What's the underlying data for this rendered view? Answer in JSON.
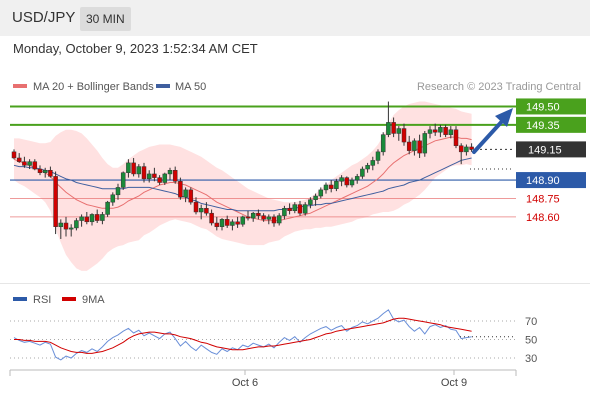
{
  "header": {
    "symbol": "USD/JPY",
    "timeframe": "30 MIN",
    "datetime": "Monday, October 9, 2023 1:52:34 AM CET"
  },
  "legend": {
    "ma20": "MA 20 + Bollinger Bands",
    "ma50": "MA 50",
    "copyright": "Research © 2023 Trading Central",
    "rsi": "RSI",
    "ma9": "9MA"
  },
  "colors": {
    "green": "#4aa11d",
    "blue": "#2c5aa8",
    "red": "#e87070",
    "ma20": "#e87070",
    "ma50": "#3f5f9f",
    "band": "#ffd9d9",
    "candle": "#1a8a3a",
    "bear": "#d10000"
  },
  "chart_data": [
    {
      "type": "candlestick",
      "ylim": [
        148.42,
        149.74
      ],
      "levels": [
        {
          "label": "149.50",
          "value": 149.5,
          "kind": "resistance"
        },
        {
          "label": "149.35",
          "value": 149.35,
          "kind": "resistance"
        },
        {
          "label": "149.15",
          "value": 149.15,
          "kind": "current"
        },
        {
          "label": "148.90",
          "value": 148.9,
          "kind": "pivot"
        },
        {
          "label": "148.75",
          "value": 148.75,
          "kind": "support"
        },
        {
          "label": "148.60",
          "value": 148.6,
          "kind": "support"
        }
      ],
      "x_ticks": [
        "Oct 6",
        "Oct 9"
      ],
      "candles": [
        [
          149.13,
          149.15,
          149.07,
          149.08
        ],
        [
          149.08,
          149.12,
          149.04,
          149.05
        ],
        [
          149.05,
          149.09,
          149.0,
          149.02
        ],
        [
          149.02,
          149.07,
          148.99,
          149.05
        ],
        [
          149.05,
          149.07,
          148.98,
          148.99
        ],
        [
          148.99,
          149.02,
          148.94,
          148.96
        ],
        [
          148.96,
          149.0,
          148.92,
          148.98
        ],
        [
          148.98,
          149.01,
          148.92,
          148.93
        ],
        [
          148.93,
          148.97,
          148.46,
          148.52
        ],
        [
          148.52,
          148.58,
          148.42,
          148.55
        ],
        [
          148.55,
          148.6,
          148.44,
          148.5
        ],
        [
          148.5,
          148.54,
          148.44,
          148.51
        ],
        [
          148.51,
          148.59,
          148.49,
          148.57
        ],
        [
          148.57,
          148.62,
          148.52,
          148.6
        ],
        [
          148.6,
          148.64,
          148.54,
          148.56
        ],
        [
          148.56,
          148.63,
          148.53,
          148.62
        ],
        [
          148.62,
          148.66,
          148.55,
          148.57
        ],
        [
          148.57,
          148.64,
          148.54,
          148.62
        ],
        [
          148.62,
          148.73,
          148.6,
          148.72
        ],
        [
          148.72,
          148.8,
          148.69,
          148.78
        ],
        [
          148.78,
          148.87,
          148.74,
          148.84
        ],
        [
          148.84,
          148.97,
          148.82,
          148.96
        ],
        [
          148.96,
          149.07,
          148.92,
          149.04
        ],
        [
          149.04,
          149.08,
          148.93,
          148.95
        ],
        [
          148.95,
          149.03,
          148.92,
          149.01
        ],
        [
          149.01,
          149.04,
          148.88,
          148.91
        ],
        [
          148.91,
          148.98,
          148.88,
          148.95
        ],
        [
          148.95,
          149.0,
          148.89,
          148.92
        ],
        [
          148.92,
          148.94,
          148.86,
          148.88
        ],
        [
          148.88,
          148.96,
          148.86,
          148.95
        ],
        [
          148.95,
          149.0,
          148.9,
          148.98
        ],
        [
          148.98,
          149.01,
          148.87,
          148.89
        ],
        [
          148.89,
          148.92,
          148.74,
          148.76
        ],
        [
          148.76,
          148.84,
          148.72,
          148.82
        ],
        [
          148.82,
          148.84,
          148.7,
          148.72
        ],
        [
          148.72,
          148.76,
          148.62,
          148.64
        ],
        [
          148.64,
          148.7,
          148.58,
          148.67
        ],
        [
          148.67,
          148.72,
          148.61,
          148.63
        ],
        [
          148.63,
          148.66,
          148.53,
          148.55
        ],
        [
          148.55,
          148.6,
          148.49,
          148.52
        ],
        [
          148.52,
          148.59,
          148.49,
          148.58
        ],
        [
          148.58,
          148.61,
          148.51,
          148.53
        ],
        [
          148.53,
          148.58,
          148.49,
          148.56
        ],
        [
          148.56,
          148.6,
          148.51,
          148.54
        ],
        [
          148.54,
          148.61,
          148.52,
          148.6
        ],
        [
          148.6,
          148.65,
          148.57,
          148.59
        ],
        [
          148.59,
          148.64,
          148.56,
          148.63
        ],
        [
          148.63,
          148.66,
          148.58,
          148.61
        ],
        [
          148.61,
          148.63,
          148.56,
          148.58
        ],
        [
          148.58,
          148.62,
          148.54,
          148.6
        ],
        [
          148.6,
          148.62,
          148.52,
          148.55
        ],
        [
          148.55,
          148.63,
          148.53,
          148.61
        ],
        [
          148.61,
          148.69,
          148.58,
          148.67
        ],
        [
          148.67,
          148.71,
          148.62,
          148.65
        ],
        [
          148.65,
          148.72,
          148.63,
          148.7
        ],
        [
          148.7,
          148.73,
          148.61,
          148.63
        ],
        [
          148.63,
          148.72,
          148.61,
          148.7
        ],
        [
          148.7,
          148.76,
          148.67,
          148.74
        ],
        [
          148.74,
          148.79,
          148.69,
          148.77
        ],
        [
          148.77,
          148.84,
          148.75,
          148.82
        ],
        [
          148.82,
          148.88,
          148.79,
          148.86
        ],
        [
          148.86,
          148.9,
          148.8,
          148.83
        ],
        [
          148.83,
          148.91,
          148.81,
          148.89
        ],
        [
          148.89,
          148.94,
          148.85,
          148.92
        ],
        [
          148.92,
          148.93,
          148.84,
          148.86
        ],
        [
          148.86,
          148.92,
          148.84,
          148.9
        ],
        [
          148.9,
          148.95,
          148.87,
          148.93
        ],
        [
          148.93,
          149.01,
          148.91,
          148.99
        ],
        [
          148.99,
          149.04,
          148.96,
          149.02
        ],
        [
          149.02,
          149.09,
          148.98,
          149.06
        ],
        [
          149.06,
          149.15,
          149.03,
          149.13
        ],
        [
          149.13,
          149.29,
          149.1,
          149.27
        ],
        [
          149.27,
          149.54,
          149.25,
          149.37
        ],
        [
          149.37,
          149.41,
          149.25,
          149.28
        ],
        [
          149.28,
          149.34,
          149.22,
          149.32
        ],
        [
          149.32,
          149.36,
          149.18,
          149.21
        ],
        [
          149.21,
          149.26,
          149.11,
          149.14
        ],
        [
          149.14,
          149.24,
          149.1,
          149.22
        ],
        [
          149.22,
          149.27,
          149.08,
          149.12
        ],
        [
          149.12,
          149.3,
          149.09,
          149.28
        ],
        [
          149.28,
          149.34,
          149.24,
          149.31
        ],
        [
          149.31,
          149.36,
          149.26,
          149.29
        ],
        [
          149.29,
          149.35,
          149.25,
          149.33
        ],
        [
          149.33,
          149.35,
          149.25,
          149.27
        ],
        [
          149.27,
          149.34,
          149.24,
          149.31
        ],
        [
          149.31,
          149.34,
          149.16,
          149.18
        ],
        [
          149.18,
          149.2,
          149.03,
          149.13
        ],
        [
          149.13,
          149.19,
          149.1,
          149.17
        ],
        [
          149.17,
          149.2,
          149.13,
          149.15
        ]
      ],
      "ma20": [
        149.07,
        149.05,
        149.04,
        149.02,
        149.0,
        148.98,
        148.96,
        148.93,
        148.88,
        148.84,
        148.8,
        148.77,
        148.74,
        148.72,
        148.7,
        148.69,
        148.68,
        148.67,
        148.67,
        148.67,
        148.68,
        148.7,
        148.73,
        148.75,
        148.77,
        148.8,
        148.82,
        148.84,
        148.86,
        148.87,
        148.88,
        148.88,
        148.87,
        148.86,
        148.84,
        148.82,
        148.8,
        148.78,
        148.75,
        148.72,
        148.7,
        148.68,
        148.66,
        148.64,
        148.62,
        148.6,
        148.59,
        148.58,
        148.57,
        148.57,
        148.57,
        148.57,
        148.58,
        148.59,
        148.6,
        148.61,
        148.62,
        148.63,
        148.65,
        148.67,
        148.69,
        148.71,
        148.73,
        148.75,
        148.77,
        148.79,
        148.81,
        148.83,
        148.85,
        148.88,
        148.91,
        148.95,
        149.0,
        149.04,
        149.07,
        149.1,
        149.12,
        149.14,
        149.16,
        149.18,
        149.2,
        149.22,
        149.23,
        149.24,
        149.25,
        149.25,
        149.24,
        149.24,
        149.23
      ],
      "ma50": [
        149.02,
        149.01,
        149.01,
        149.0,
        149.0,
        148.99,
        148.98,
        148.97,
        148.95,
        148.93,
        148.91,
        148.9,
        148.88,
        148.87,
        148.86,
        148.85,
        148.84,
        148.83,
        148.83,
        148.83,
        148.83,
        148.83,
        148.84,
        148.84,
        148.84,
        148.84,
        148.84,
        148.83,
        148.82,
        148.81,
        148.8,
        148.79,
        148.77,
        148.76,
        148.74,
        148.73,
        148.71,
        148.7,
        148.69,
        148.68,
        148.67,
        148.66,
        148.66,
        148.65,
        148.65,
        148.65,
        148.65,
        148.65,
        148.65,
        148.65,
        148.65,
        148.66,
        148.66,
        148.67,
        148.67,
        148.68,
        148.69,
        148.69,
        148.7,
        148.7,
        148.71,
        148.71,
        148.72,
        148.73,
        148.74,
        148.75,
        148.76,
        148.77,
        148.78,
        148.79,
        148.8,
        148.81,
        148.83,
        148.84,
        148.85,
        148.86,
        148.88,
        148.89,
        148.9,
        148.92,
        148.94,
        148.96,
        148.98,
        149.0,
        149.02,
        149.04,
        149.06,
        149.07,
        149.08
      ],
      "bb_upper": [
        149.24,
        149.24,
        149.23,
        149.22,
        149.21,
        149.2,
        149.2,
        149.21,
        149.26,
        149.29,
        149.31,
        149.31,
        149.3,
        149.28,
        149.24,
        149.19,
        149.14,
        149.08,
        149.03,
        149.0,
        149.0,
        149.03,
        149.07,
        149.1,
        149.13,
        149.15,
        149.17,
        149.18,
        149.19,
        149.19,
        149.19,
        149.18,
        149.17,
        149.15,
        149.13,
        149.11,
        149.09,
        149.06,
        149.03,
        149.0,
        148.98,
        148.95,
        148.92,
        148.89,
        148.86,
        148.83,
        148.81,
        148.79,
        148.77,
        148.75,
        148.74,
        148.73,
        148.72,
        148.72,
        148.72,
        148.73,
        148.74,
        148.76,
        148.79,
        148.83,
        148.86,
        148.9,
        148.93,
        148.96,
        148.99,
        149.02,
        149.04,
        149.07,
        149.1,
        149.14,
        149.19,
        149.26,
        149.36,
        149.43,
        149.47,
        149.5,
        149.52,
        149.53,
        149.54,
        149.54,
        149.53,
        149.52,
        149.51,
        149.5,
        149.49,
        149.48,
        149.46,
        149.45,
        149.44
      ],
      "bb_lower": [
        148.9,
        148.87,
        148.85,
        148.82,
        148.79,
        148.76,
        148.72,
        148.65,
        148.5,
        148.39,
        148.29,
        148.23,
        148.18,
        148.16,
        148.16,
        148.19,
        148.22,
        148.26,
        148.31,
        148.34,
        148.36,
        148.37,
        148.39,
        148.4,
        148.41,
        148.45,
        148.47,
        148.5,
        148.53,
        148.55,
        148.57,
        148.58,
        148.57,
        148.56,
        148.55,
        148.53,
        148.51,
        148.5,
        148.47,
        148.44,
        148.42,
        148.41,
        148.4,
        148.39,
        148.38,
        148.37,
        148.37,
        148.37,
        148.37,
        148.39,
        148.4,
        148.41,
        148.44,
        148.46,
        148.48,
        148.49,
        148.5,
        148.5,
        148.51,
        148.51,
        148.52,
        148.52,
        148.53,
        148.54,
        148.55,
        148.56,
        148.58,
        148.59,
        148.6,
        148.62,
        148.63,
        148.64,
        148.64,
        148.65,
        148.67,
        148.7,
        148.72,
        148.75,
        148.78,
        148.82,
        148.87,
        148.92,
        148.95,
        148.98,
        149.01,
        149.02,
        149.02,
        149.03,
        149.02
      ]
    },
    {
      "type": "line",
      "ylim": [
        20,
        80
      ],
      "y_ticks": [
        "70",
        "50",
        "30"
      ],
      "y_tick_values": [
        70,
        50,
        30
      ],
      "series": [
        {
          "name": "RSI",
          "values": [
            52,
            49,
            47,
            48,
            46,
            44,
            47,
            45,
            31,
            28,
            32,
            30,
            35,
            38,
            36,
            40,
            37,
            42,
            48,
            52,
            55,
            59,
            62,
            57,
            60,
            54,
            57,
            54,
            51,
            56,
            58,
            51,
            43,
            48,
            42,
            38,
            44,
            40,
            36,
            34,
            40,
            37,
            41,
            39,
            44,
            42,
            46,
            44,
            42,
            45,
            41,
            47,
            52,
            49,
            53,
            47,
            52,
            56,
            59,
            62,
            64,
            60,
            63,
            65,
            59,
            63,
            65,
            69,
            67,
            70,
            73,
            78,
            82,
            72,
            69,
            71,
            64,
            59,
            63,
            56,
            64,
            66,
            63,
            65,
            61,
            60,
            51,
            52,
            53
          ]
        },
        {
          "name": "9MA",
          "values": [
            50,
            50,
            49,
            49,
            48,
            48,
            48,
            47,
            44,
            41,
            39,
            37,
            36,
            36,
            35,
            35,
            36,
            37,
            39,
            41,
            44,
            47,
            51,
            54,
            56,
            57,
            58,
            58,
            57,
            56,
            56,
            55,
            53,
            52,
            51,
            49,
            47,
            46,
            44,
            42,
            41,
            40,
            39,
            39,
            39,
            40,
            41,
            42,
            42,
            43,
            43,
            44,
            45,
            46,
            47,
            48,
            49,
            50,
            52,
            54,
            56,
            57,
            59,
            60,
            61,
            62,
            63,
            64,
            65,
            66,
            67,
            68,
            70,
            72,
            73,
            73,
            72,
            71,
            70,
            69,
            68,
            67,
            66,
            64,
            63,
            62,
            61,
            60,
            59
          ]
        }
      ],
      "x_ticks": [
        "Oct 6",
        "Oct 9"
      ]
    }
  ]
}
